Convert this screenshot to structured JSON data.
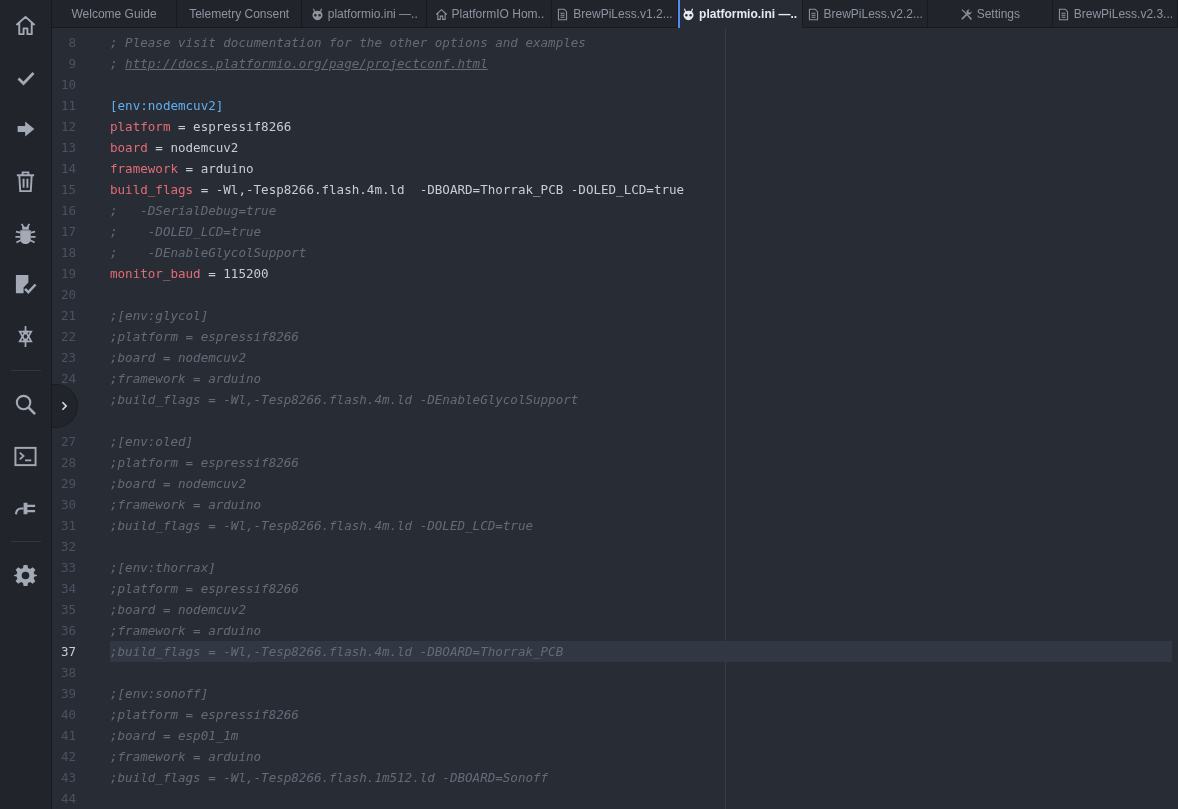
{
  "tabs": [
    {
      "kind": "text",
      "label": "Welcome Guide",
      "selected": false
    },
    {
      "kind": "text",
      "label": "Telemetry Consent",
      "selected": false
    },
    {
      "kind": "ini",
      "label": "platformio.ini —..",
      "selected": false
    },
    {
      "kind": "home",
      "label": "PlatformIO Hom..",
      "selected": false
    },
    {
      "kind": "file",
      "label": "BrewPiLess.v1.2...",
      "selected": false
    },
    {
      "kind": "ini",
      "label": "platformio.ini —..",
      "selected": true
    },
    {
      "kind": "file",
      "label": "BrewPiLess.v2.2...",
      "selected": false
    },
    {
      "kind": "settings",
      "label": "Settings",
      "selected": false
    },
    {
      "kind": "file",
      "label": "BrewPiLess.v2.3...",
      "selected": false
    }
  ],
  "editor": {
    "lines": [
      {
        "number": "8",
        "cursor": false,
        "tokens": [
          {
            "kind": "comment",
            "text": "; Please visit documentation for the other options and examples"
          }
        ]
      },
      {
        "number": "9",
        "cursor": false,
        "tokens": [
          {
            "kind": "comment",
            "text": "; "
          },
          {
            "kind": "link",
            "text": "http://docs.platformio.org/page/projectconf.html"
          }
        ]
      },
      {
        "number": "10",
        "cursor": false
      },
      {
        "number": "11",
        "cursor": false,
        "tokens": [
          {
            "kind": "section",
            "text": "[env:nodemcuv2]"
          }
        ]
      },
      {
        "number": "12",
        "cursor": false,
        "tokens": [
          {
            "kind": "key",
            "text": "platform"
          },
          {
            "kind": "plain",
            "text": " = espressif8266"
          }
        ]
      },
      {
        "number": "13",
        "cursor": false,
        "tokens": [
          {
            "kind": "key",
            "text": "board"
          },
          {
            "kind": "plain",
            "text": " = nodemcuv2"
          }
        ]
      },
      {
        "number": "14",
        "cursor": false,
        "tokens": [
          {
            "kind": "key",
            "text": "framework"
          },
          {
            "kind": "plain",
            "text": " = arduino"
          }
        ]
      },
      {
        "number": "15",
        "cursor": false,
        "tokens": [
          {
            "kind": "key",
            "text": "build_flags"
          },
          {
            "kind": "plain",
            "text": " = -Wl,-Tesp8266.flash.4m.ld  -DBOARD=Thorrak_PCB -DOLED_LCD=true"
          }
        ]
      },
      {
        "number": "16",
        "cursor": false,
        "tokens": [
          {
            "kind": "comment",
            "text": ";   -DSerialDebug=true"
          }
        ]
      },
      {
        "number": "17",
        "cursor": false,
        "tokens": [
          {
            "kind": "comment",
            "text": ";    -DOLED_LCD=true"
          }
        ]
      },
      {
        "number": "18",
        "cursor": false,
        "tokens": [
          {
            "kind": "comment",
            "text": ";    -DEnableGlycolSupport"
          }
        ]
      },
      {
        "number": "19",
        "cursor": false,
        "tokens": [
          {
            "kind": "key",
            "text": "monitor_baud"
          },
          {
            "kind": "plain",
            "text": " = 115200"
          }
        ]
      },
      {
        "number": "20",
        "cursor": false
      },
      {
        "number": "21",
        "cursor": false,
        "tokens": [
          {
            "kind": "comment",
            "text": ";[env:glycol]"
          }
        ]
      },
      {
        "number": "22",
        "cursor": false,
        "tokens": [
          {
            "kind": "comment",
            "text": ";platform = espressif8266"
          }
        ]
      },
      {
        "number": "23",
        "cursor": false,
        "tokens": [
          {
            "kind": "comment",
            "text": ";board = nodemcuv2"
          }
        ]
      },
      {
        "number": "24",
        "cursor": false,
        "tokens": [
          {
            "kind": "comment",
            "text": ";framework = arduino"
          }
        ]
      },
      {
        "cursor": false,
        "tokens": [
          {
            "kind": "comment",
            "text": ";build_flags = -Wl,-Tesp8266.flash.4m.ld -DEnableGlycolSupport"
          }
        ]
      },
      {
        "cursor": false
      },
      {
        "number": "27",
        "cursor": false,
        "tokens": [
          {
            "kind": "comment",
            "text": ";[env:oled]"
          }
        ]
      },
      {
        "number": "28",
        "cursor": false,
        "tokens": [
          {
            "kind": "comment",
            "text": ";platform = espressif8266"
          }
        ]
      },
      {
        "number": "29",
        "cursor": false,
        "tokens": [
          {
            "kind": "comment",
            "text": ";board = nodemcuv2"
          }
        ]
      },
      {
        "number": "30",
        "cursor": false,
        "tokens": [
          {
            "kind": "comment",
            "text": ";framework = arduino"
          }
        ]
      },
      {
        "number": "31",
        "cursor": false,
        "tokens": [
          {
            "kind": "comment",
            "text": ";build_flags = -Wl,-Tesp8266.flash.4m.ld -DOLED_LCD=true"
          }
        ]
      },
      {
        "number": "32",
        "cursor": false
      },
      {
        "number": "33",
        "cursor": false,
        "tokens": [
          {
            "kind": "comment",
            "text": ";[env:thorrax]"
          }
        ]
      },
      {
        "number": "34",
        "cursor": false,
        "tokens": [
          {
            "kind": "comment",
            "text": ";platform = espressif8266"
          }
        ]
      },
      {
        "number": "35",
        "cursor": false,
        "tokens": [
          {
            "kind": "comment",
            "text": ";board = nodemcuv2"
          }
        ]
      },
      {
        "number": "36",
        "cursor": false,
        "tokens": [
          {
            "kind": "comment",
            "text": ";framework = arduino"
          }
        ]
      },
      {
        "number": "37",
        "cursor": true,
        "tokens": [
          {
            "kind": "comment",
            "text": ";build_flags = -Wl,-Tesp8266.flash.4m.ld -DBOARD=Thorrak_PCB"
          }
        ]
      },
      {
        "number": "38",
        "cursor": false
      },
      {
        "number": "39",
        "cursor": false,
        "tokens": [
          {
            "kind": "comment",
            "text": ";[env:sonoff]"
          }
        ]
      },
      {
        "number": "40",
        "cursor": false,
        "tokens": [
          {
            "kind": "comment",
            "text": ";platform = espressif8266"
          }
        ]
      },
      {
        "number": "41",
        "cursor": false,
        "tokens": [
          {
            "kind": "comment",
            "text": ";board = esp01_1m"
          }
        ]
      },
      {
        "number": "42",
        "cursor": false,
        "tokens": [
          {
            "kind": "comment",
            "text": ";framework = arduino"
          }
        ]
      },
      {
        "number": "43",
        "cursor": false,
        "tokens": [
          {
            "kind": "comment",
            "text": ";build_flags = -Wl,-Tesp8266.flash.1m512.ld -DBOARD=Sonoff"
          }
        ]
      },
      {
        "number": "44",
        "cursor": false
      }
    ]
  }
}
